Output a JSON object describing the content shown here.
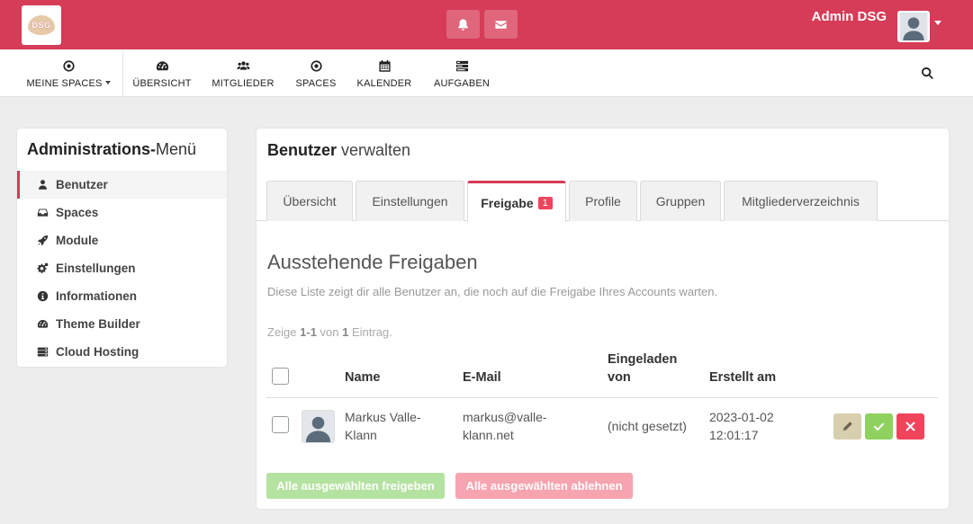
{
  "header": {
    "logo_text": "DSG",
    "user_name": "Admin DSG",
    "icons": [
      "bell-icon",
      "envelope-icon"
    ]
  },
  "nav": {
    "items": [
      {
        "label": "MEINE SPACES",
        "icon": "target-icon"
      },
      {
        "label": "ÜBERSICHT",
        "icon": "dashboard-icon"
      },
      {
        "label": "MITGLIEDER",
        "icon": "users-icon"
      },
      {
        "label": "SPACES",
        "icon": "target-icon"
      },
      {
        "label": "KALENDER",
        "icon": "calendar-icon"
      },
      {
        "label": "AUFGABEN",
        "icon": "tasks-icon"
      }
    ]
  },
  "sidebar": {
    "title_bold": "Administrations-",
    "title_rest": "Menü",
    "items": [
      {
        "label": "Benutzer",
        "icon": "user-icon",
        "active": true
      },
      {
        "label": "Spaces",
        "icon": "inbox-icon"
      },
      {
        "label": "Module",
        "icon": "rocket-icon"
      },
      {
        "label": "Einstellungen",
        "icon": "cogs-icon"
      },
      {
        "label": "Informationen",
        "icon": "info-icon"
      },
      {
        "label": "Theme Builder",
        "icon": "dashboard-icon"
      },
      {
        "label": "Cloud Hosting",
        "icon": "server-icon"
      }
    ]
  },
  "panel": {
    "title_bold": "Benutzer",
    "title_rest": "verwalten",
    "tabs": [
      {
        "label": "Übersicht"
      },
      {
        "label": "Einstellungen"
      },
      {
        "label": "Freigabe",
        "badge": "1",
        "active": true
      },
      {
        "label": "Profile"
      },
      {
        "label": "Gruppen"
      },
      {
        "label": "Mitgliederverzeichnis"
      }
    ],
    "section_title": "Ausstehende Freigaben",
    "section_desc": "Diese Liste zeigt dir alle Benutzer an, die noch auf die Freigabe Ihres Accounts warten.",
    "summary": {
      "prefix": "Zeige ",
      "range": "1-1",
      "mid": " von ",
      "total": "1",
      "suffix": " Eintrag."
    },
    "table": {
      "headers": {
        "name": "Name",
        "email": "E-Mail",
        "invited_line1": "Eingeladen",
        "invited_line2": "von",
        "created": "Erstellt am"
      },
      "rows": [
        {
          "name_line1": "Markus Valle-",
          "name_line2": "Klann",
          "email_line1": "markus@valle-",
          "email_line2": "klann.net",
          "invited_by": "(nicht gesetzt)",
          "created_line1": "2023-01-02",
          "created_line2": "12:01:17"
        }
      ]
    },
    "bulk": {
      "approve_label": "Alle ausgewählten freigeben",
      "decline_label": "Alle ausgewählten ablehnen"
    }
  },
  "colors": {
    "brand": "#d63b57",
    "approve": "#8fd15f",
    "decline": "#f0435c",
    "edit": "#d7cfad"
  }
}
